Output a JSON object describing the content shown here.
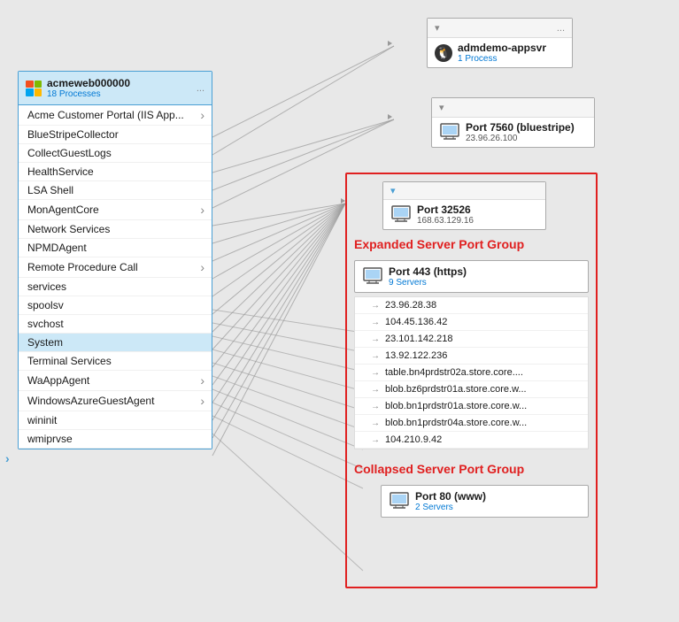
{
  "processPanel": {
    "title": "acmeweb000000",
    "subtitle": "18 Processes",
    "moreLabel": "...",
    "items": [
      {
        "label": "Acme Customer Portal (IIS App...",
        "hasArrow": true,
        "selected": false
      },
      {
        "label": "BlueStripeCollector",
        "hasArrow": false,
        "selected": false
      },
      {
        "label": "CollectGuestLogs",
        "hasArrow": false,
        "selected": false
      },
      {
        "label": "HealthService",
        "hasArrow": false,
        "selected": false
      },
      {
        "label": "LSA Shell",
        "hasArrow": false,
        "selected": false
      },
      {
        "label": "MonAgentCore",
        "hasArrow": true,
        "selected": false
      },
      {
        "label": "Network Services",
        "hasArrow": false,
        "selected": false
      },
      {
        "label": "NPMDAgent",
        "hasArrow": false,
        "selected": false
      },
      {
        "label": "Remote Procedure Call",
        "hasArrow": true,
        "selected": false
      },
      {
        "label": "services",
        "hasArrow": false,
        "selected": false
      },
      {
        "label": "spoolsv",
        "hasArrow": false,
        "selected": false
      },
      {
        "label": "svchost",
        "hasArrow": false,
        "selected": false
      },
      {
        "label": "System",
        "hasArrow": false,
        "selected": true
      },
      {
        "label": "Terminal Services",
        "hasArrow": false,
        "selected": false
      },
      {
        "label": "WaAppAgent",
        "hasArrow": true,
        "selected": false
      },
      {
        "label": "WindowsAzureGuestAgent",
        "hasArrow": true,
        "selected": false
      },
      {
        "label": "wininit",
        "hasArrow": false,
        "selected": false
      },
      {
        "label": "wmiprvse",
        "hasArrow": false,
        "selected": false
      }
    ]
  },
  "appsvrNode": {
    "name": "admdemo-appsvr",
    "subtitle": "1 Process",
    "moreLabel": "..."
  },
  "port7560Node": {
    "name": "Port 7560 (bluestripe)",
    "ip": "23.96.26.100"
  },
  "port32526Node": {
    "name": "Port 32526",
    "ip": "168.63.129.16"
  },
  "expandedGroup": {
    "title": "Expanded Server Port Group",
    "port443": {
      "name": "Port 443 (https)",
      "subtitle": "9 Servers"
    },
    "ips": [
      "23.96.28.38",
      "104.45.136.42",
      "23.101.142.218",
      "13.92.122.236",
      "table.bn4prdstr02a.store.core....",
      "blob.bz6prdstr01a.store.core.w...",
      "blob.bn1prdstr01a.store.core.w...",
      "blob.bn1prdstr04a.store.core.w...",
      "104.210.9.42"
    ]
  },
  "collapsedGroup": {
    "title": "Collapsed Server Port Group",
    "port80": {
      "name": "Port 80 (www)",
      "subtitle": "2 Servers"
    }
  },
  "icons": {
    "monitor": "monitor-icon",
    "linux": "🐧",
    "chevronDown": "▾",
    "more": "...",
    "arrowRight": "→"
  }
}
